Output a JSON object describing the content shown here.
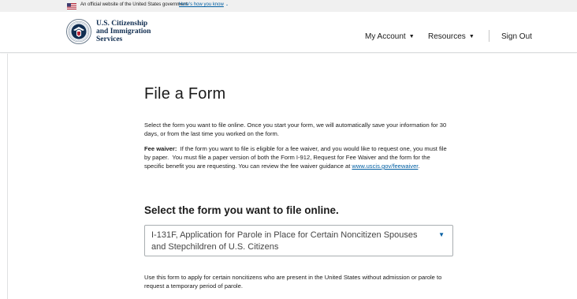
{
  "gov_banner": {
    "text": "An official website of the United States government",
    "link": "Here's how you know",
    "link_chevron": "⌄"
  },
  "header": {
    "logo_lines": [
      "U.S. Citizenship",
      "and Immigration",
      "Services"
    ],
    "nav": [
      {
        "label": "My Account",
        "caret": "▼"
      },
      {
        "label": "Resources",
        "caret": "▼"
      },
      {
        "label": "Sign Out"
      }
    ]
  },
  "main": {
    "title": "File a Form",
    "intro": "Select the form you want to file online. Once you start your form, we will automatically save your information for 30 days, or from the last time you worked on the form.",
    "fee_label": "Fee waiver:",
    "fee_text": "  If the form you want to file is eligible for a fee waiver, and you would like to request one, you must file by paper.  You must file a paper version of both the Form I-912, Request for Fee Waiver and the form for the specific benefit you are requesting. You can review the fee waiver guidance at ",
    "fee_link": "www.uscis.gov/feewaiver",
    "fee_end": ".",
    "select_heading": "Select the form you want to file online.",
    "select_value": "I-131F, Application for Parole in Place for Certain Noncitizen Spouses and Stepchildren of U.S. Citizens",
    "select_caret": "▼",
    "form_description": "Use this form to apply for certain noncitizens who are present in the United States without admission or parole to request a temporary period of parole."
  },
  "colors": {
    "link": "#005ea2",
    "logo_navy": "#112e51",
    "banner_bg": "#f0f0f0"
  }
}
